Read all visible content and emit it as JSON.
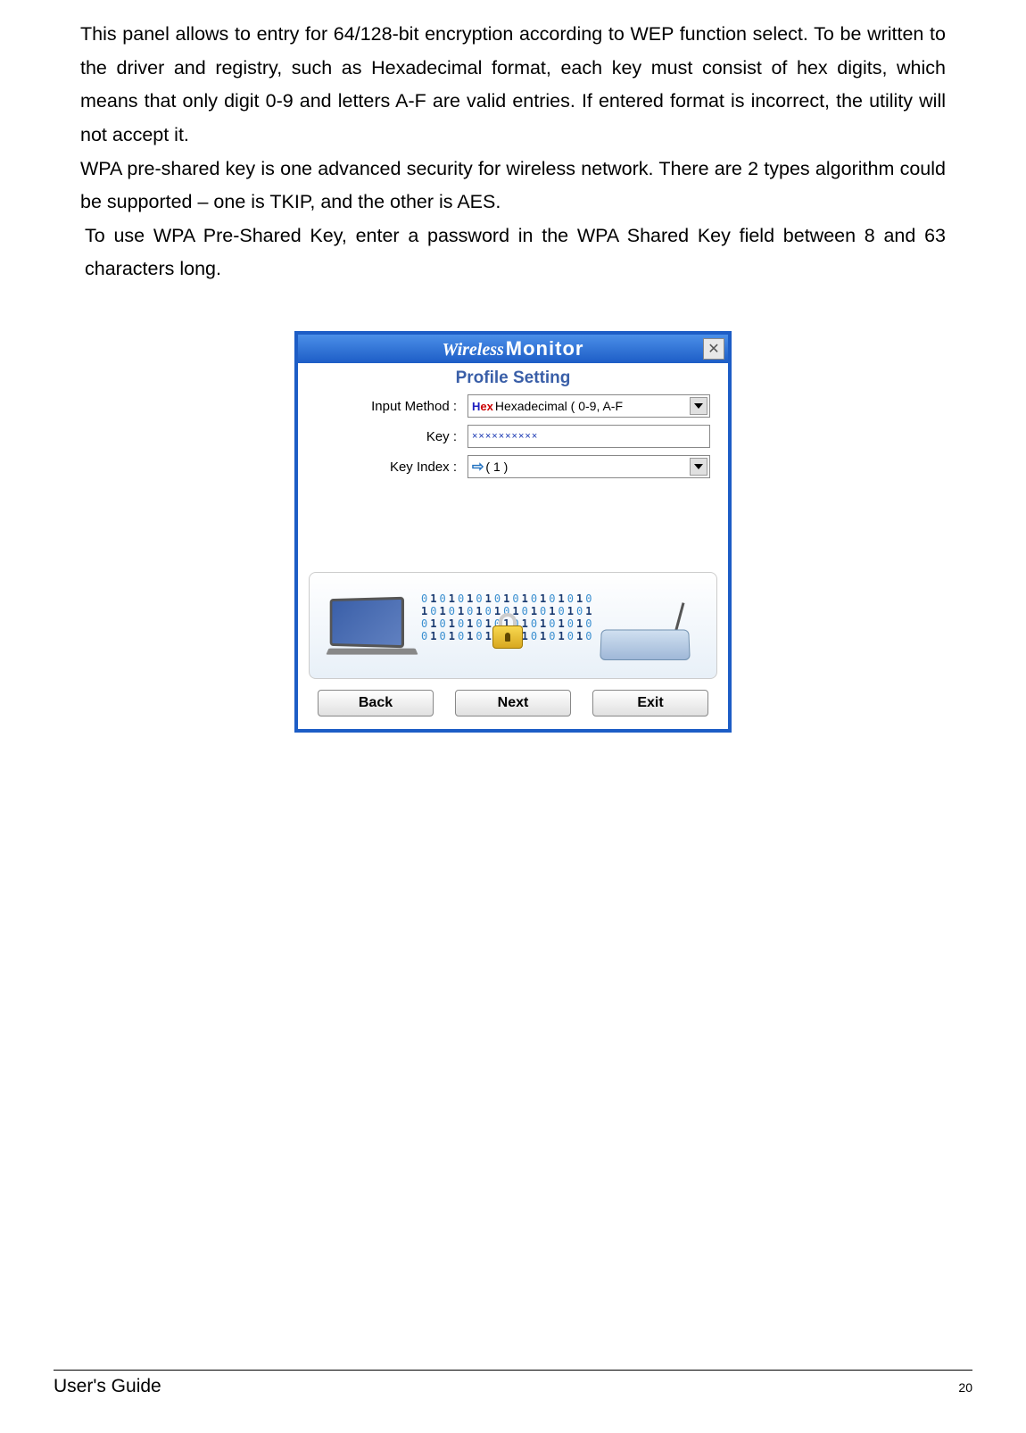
{
  "paragraphs": {
    "p1": "This panel allows to entry for 64/128-bit encryption according to WEP function select. To be written to the driver and registry, such as Hexadecimal format, each key must consist of hex digits, which means that only digit 0-9 and letters A-F are valid entries. If entered format is incorrect, the utility will not accept it.",
    "p2": "WPA pre-shared key is one advanced security for wireless network. There are 2 types algorithm could be supported – one is TKIP, and the other is AES.",
    "p3": "To use WPA Pre-Shared Key, enter a password in the WPA Shared Key field between 8 and 63 characters long."
  },
  "dialog": {
    "title_wireless": "Wireless",
    "title_monitor": "Monitor",
    "close_glyph": "✕",
    "subtitle": "Profile Setting",
    "labels": {
      "input_method": "Input Method :",
      "key": "Key :",
      "key_index": "Key Index :"
    },
    "fields": {
      "input_method_prefix_h": "H",
      "input_method_prefix_ex": "ex",
      "input_method_value": "Hexadecimal ( 0-9, A-F",
      "key_value": "××××××××××",
      "key_index_icon": "⇨",
      "key_index_value": "( 1 )"
    },
    "buttons": {
      "back": "Back",
      "next": "Next",
      "exit": "Exit"
    },
    "binary_lines": [
      "010101010101010101010",
      "101010101010101010101",
      "010101010101010101010",
      "010101010101010101010"
    ]
  },
  "footer": {
    "left": "User's Guide",
    "right": "20"
  }
}
